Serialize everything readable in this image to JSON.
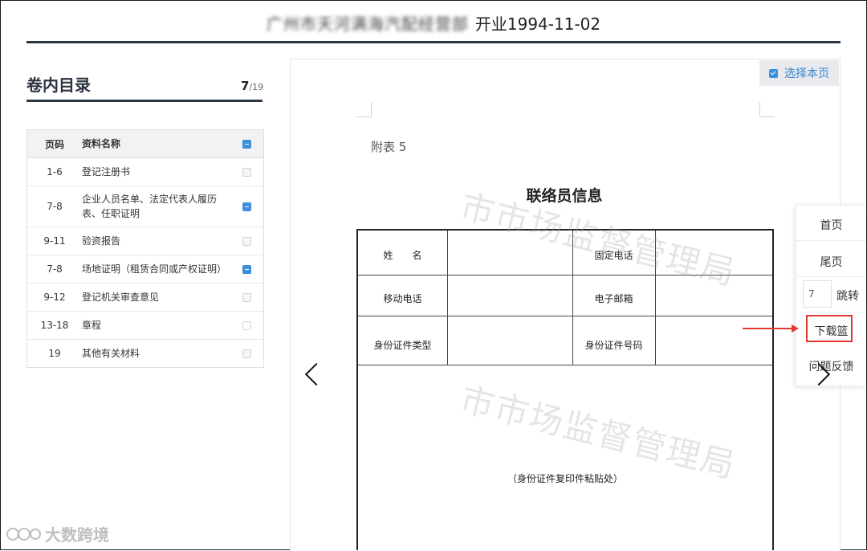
{
  "header": {
    "company_name_blurred": "广州市天河满海汽配经营部",
    "opened_label": "开业1994-11-02"
  },
  "sidebar": {
    "title": "卷内目录",
    "current_page": "7",
    "total_pages": "/19",
    "columns": {
      "page": "页码",
      "name": "资料名称"
    },
    "items": [
      {
        "pages": "1-6",
        "name": "登记注册书",
        "checked": false
      },
      {
        "pages": "7-8",
        "name": "企业人员名单、法定代表人履历表、任职证明",
        "checked": true
      },
      {
        "pages": "9-11",
        "name": "验资报告",
        "checked": false
      },
      {
        "pages": "7-8",
        "name": "场地证明（租赁合同或产权证明）",
        "checked": true
      },
      {
        "pages": "9-12",
        "name": "登记机关审查意见",
        "checked": false
      },
      {
        "pages": "13-18",
        "name": "章程",
        "checked": false
      },
      {
        "pages": "19",
        "name": "其他有关材料",
        "checked": false
      }
    ]
  },
  "viewer": {
    "select_page_label": "选择本页",
    "document": {
      "appendix_label": "附表 5",
      "title": "联络员信息",
      "watermark": "市市场监督管理局",
      "fields": {
        "name": "姓　　名",
        "landline": "固定电话",
        "mobile": "移动电话",
        "email": "电子邮箱",
        "id_type": "身份证件类型",
        "id_number": "身份证件号码"
      },
      "paste_note": "（身份证件复印件粘贴处）"
    }
  },
  "tools": {
    "first_page": "首页",
    "last_page": "尾页",
    "jump_value": "7",
    "jump_label": "跳转",
    "download_basket": "下载篮",
    "feedback": "问题反馈"
  },
  "watermark_logo": {
    "text": "大数跨境"
  },
  "colors": {
    "accent": "#3d8fd9",
    "highlight": "#e03a2f",
    "rule": "#2a3845"
  }
}
